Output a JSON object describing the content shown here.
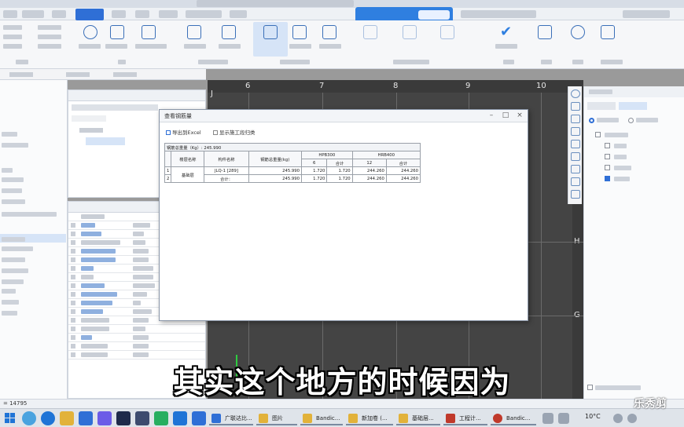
{
  "grid": {
    "top_axis": [
      "J",
      "6",
      "7",
      "8",
      "9",
      "10"
    ],
    "right_axis": [
      "H",
      "G"
    ]
  },
  "dialog": {
    "title": "查看钢筋量",
    "export_btn": "导出到Excel",
    "show_construction": "显示施工段归类",
    "table": {
      "caption": "钢筋总重量（Kg）: 245.990",
      "headers": {
        "floor": "楼层名称",
        "component": "构件名称",
        "total_weight": "钢筋总重量(kg)",
        "group_a": "HPB300",
        "group_b": "HRB400",
        "dia_a": "6",
        "subtotal_a": "合计",
        "dia_b": "12",
        "subtotal_b": "合计"
      },
      "floor_name": "基础层",
      "rows": [
        {
          "idx": "1",
          "name": "JLQ-1 [289]",
          "total": "245.990",
          "c6": "1.720",
          "sub_a": "1.720",
          "c12": "244.260",
          "sub_b": "244.260"
        },
        {
          "idx": "2",
          "name": "合计：",
          "total": "245.990",
          "c6": "1.720",
          "sub_a": "1.720",
          "c12": "244.260",
          "sub_b": "244.260"
        }
      ]
    }
  },
  "status": {
    "coord": "= 14795"
  },
  "subtitle": "其实这个地方的时候因为",
  "watermark": "乐秀剪",
  "taskbar": {
    "tasks": [
      {
        "label": "广联达比...",
        "color": "#2f6fd6"
      },
      {
        "label": "图片",
        "color": "#e2b23a"
      },
      {
        "label": "Bandic...",
        "color": "#e2b23a"
      },
      {
        "label": "新加卷 (...",
        "color": "#e2b23a"
      },
      {
        "label": "基础层...",
        "color": "#e2b23a"
      },
      {
        "label": "工程计...",
        "color": "#c0392b"
      },
      {
        "label": "Bandic...",
        "color": "#c0392b"
      }
    ],
    "weather": "10°C"
  }
}
